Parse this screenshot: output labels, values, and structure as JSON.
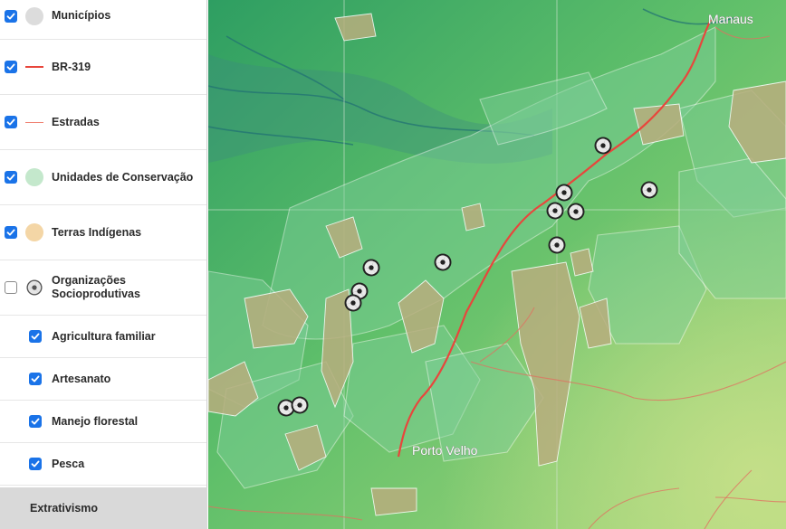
{
  "layers": [
    {
      "label": "Municípios",
      "checked": true,
      "swatch": "circle",
      "color": "#dcdcdc"
    },
    {
      "label": "BR-319",
      "checked": true,
      "swatch": "line-thick",
      "color": "#e8463c"
    },
    {
      "label": "Estradas",
      "checked": true,
      "swatch": "line-thin",
      "color": "#f08070"
    },
    {
      "label": "Unidades de Conservação",
      "checked": true,
      "swatch": "circle",
      "color": "#c4e8cc"
    },
    {
      "label": "Terras Indígenas",
      "checked": true,
      "swatch": "circle",
      "color": "#f4d6a6"
    },
    {
      "label": "Organizações Socioprodutivas",
      "checked": false,
      "swatch": "org-icon",
      "color": "#555555"
    }
  ],
  "sublayers": [
    {
      "label": "Agricultura familiar",
      "checked": true
    },
    {
      "label": "Artesanato",
      "checked": true
    },
    {
      "label": "Manejo florestal",
      "checked": true
    },
    {
      "label": "Pesca",
      "checked": true
    }
  ],
  "active_item": {
    "label": "Extrativismo"
  },
  "map": {
    "cities": [
      {
        "name": "Manaus"
      },
      {
        "name": "Porto Velho"
      }
    ],
    "colors": {
      "terrain_low": "#2e9e62",
      "terrain_mid": "#5fbf6a",
      "terrain_high": "#a8d77a",
      "river_tint": "#3b8a80",
      "indigenous": "#b8ae7e",
      "conservation": "#7fcf9a",
      "road": "#e07060",
      "br319": "#e8463c"
    }
  }
}
